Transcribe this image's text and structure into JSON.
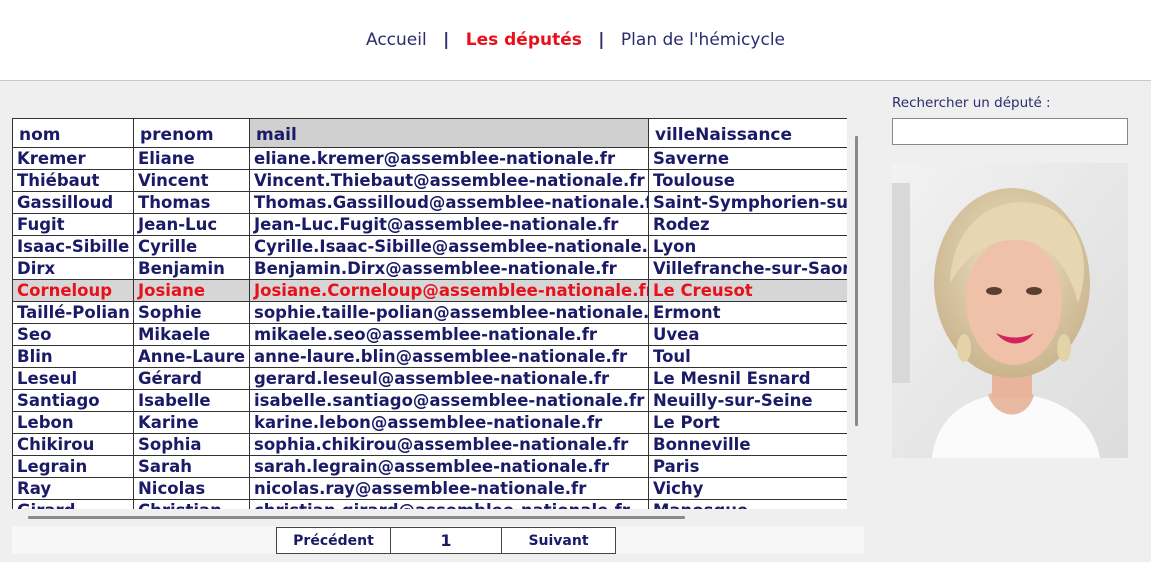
{
  "nav": {
    "items": [
      {
        "label": "Accueil",
        "active": false
      },
      {
        "label": "Les députés",
        "active": true
      },
      {
        "label": "Plan de l'hémicycle",
        "active": false
      }
    ],
    "separator": "|"
  },
  "table": {
    "columns": [
      "nom",
      "prenom",
      "mail",
      "villeNaissance"
    ],
    "sorted_column": "mail",
    "selected_row": 6,
    "rows": [
      [
        "Kremer",
        "Eliane",
        "eliane.kremer@assemblee-nationale.fr",
        "Saverne"
      ],
      [
        "Thiébaut",
        "Vincent",
        "Vincent.Thiebaut@assemblee-nationale.fr",
        "Toulouse"
      ],
      [
        "Gassilloud",
        "Thomas",
        "Thomas.Gassilloud@assemblee-nationale.fr",
        "Saint-Symphorien-sur"
      ],
      [
        "Fugit",
        "Jean-Luc",
        "Jean-Luc.Fugit@assemblee-nationale.fr",
        "Rodez"
      ],
      [
        "Isaac-Sibille",
        "Cyrille",
        "Cyrille.Isaac-Sibille@assemblee-nationale.fr",
        "Lyon"
      ],
      [
        "Dirx",
        "Benjamin",
        "Benjamin.Dirx@assemblee-nationale.fr",
        "Villefranche-sur-Saon"
      ],
      [
        "Corneloup",
        "Josiane",
        "Josiane.Corneloup@assemblee-nationale.fr",
        "Le Creusot"
      ],
      [
        "Taillé-Polian",
        "Sophie",
        "sophie.taille-polian@assemblee-nationale.fr",
        "Ermont"
      ],
      [
        "Seo",
        "Mikaele",
        "mikaele.seo@assemblee-nationale.fr",
        "Uvea"
      ],
      [
        "Blin",
        "Anne-Laure",
        "anne-laure.blin@assemblee-nationale.fr",
        "Toul"
      ],
      [
        "Leseul",
        "Gérard",
        "gerard.leseul@assemblee-nationale.fr",
        "Le Mesnil Esnard"
      ],
      [
        "Santiago",
        "Isabelle",
        "isabelle.santiago@assemblee-nationale.fr",
        "Neuilly-sur-Seine"
      ],
      [
        "Lebon",
        "Karine",
        "karine.lebon@assemblee-nationale.fr",
        "Le Port"
      ],
      [
        "Chikirou",
        "Sophia",
        "sophia.chikirou@assemblee-nationale.fr",
        "Bonneville"
      ],
      [
        "Legrain",
        "Sarah",
        "sarah.legrain@assemblee-nationale.fr",
        "Paris"
      ],
      [
        "Ray",
        "Nicolas",
        "nicolas.ray@assemblee-nationale.fr",
        "Vichy"
      ],
      [
        "Girard",
        "Christian",
        "christian.girard@assemblee-nationale.fr",
        "Manosque"
      ]
    ]
  },
  "pager": {
    "prev_label": "Précédent",
    "page": "1",
    "next_label": "Suivant"
  },
  "search": {
    "label": "Rechercher un député :",
    "value": ""
  },
  "photo": {
    "icon": "deputy-portrait"
  },
  "colors": {
    "nav_text": "#2b2b6e",
    "accent_red": "#e8101a",
    "table_text": "#1a1a66",
    "selected_row_bg": "#d6d6d6",
    "sorted_header_bg": "#d0d0d0"
  }
}
